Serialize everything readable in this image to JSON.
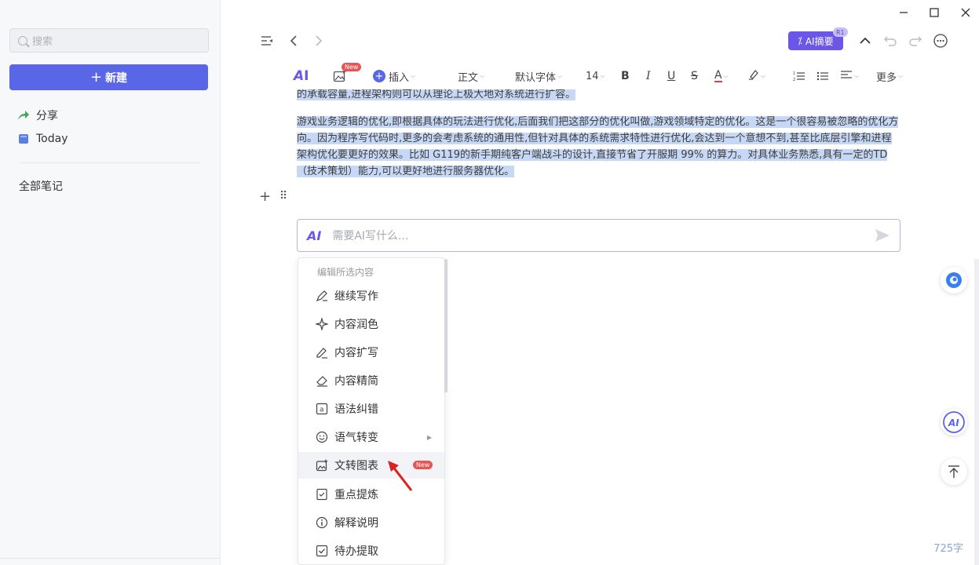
{
  "sidebar": {
    "search_placeholder": "搜索",
    "new_button": "新建",
    "items": [
      {
        "label": "分享",
        "icon": "share-arrow-icon"
      },
      {
        "label": "Today",
        "icon": "notebook-icon"
      }
    ],
    "all_notes": "全部笔记"
  },
  "topbar": {
    "ai_summary": "AI摘要",
    "r1_badge": "R1"
  },
  "toolbar": {
    "insert": "插入",
    "new_badge": "New",
    "paragraph_style": "正文",
    "font": "默认字体",
    "font_size": "14",
    "bold": "B",
    "italic": "I",
    "underline": "U",
    "strike": "S",
    "font_color": "A",
    "more": "更多"
  },
  "content": {
    "line_cut": "的承载容量,进程架构则可以从理论上极大地对系统进行扩容。",
    "paragraph": "游戏业务逻辑的优化,即根据具体的玩法进行优化,后面我们把这部分的优化叫做,游戏领域特定的优化。这是一个很容易被忽略的优化方向。因为程序写代码时,更多的会考虑系统的通用性,但针对具体的系统需求特性进行优化,会达到一个意想不到,甚至比底层引擎和进程架构优化要更好的效果。比如 G119的新手期纯客户端战斗的设计,直接节省了开服期 99% 的算力。对具体业务熟悉,具有一定的TD（技术策划）能力,可以更好地进行服务器优化。"
  },
  "ai_input": {
    "logo": "AI",
    "placeholder": "需要AI写什么..."
  },
  "menu": {
    "header": "编辑所选内容",
    "items": [
      {
        "label": "继续写作",
        "icon": "pen-write-icon"
      },
      {
        "label": "内容润色",
        "icon": "sparkle-icon"
      },
      {
        "label": "内容扩写",
        "icon": "pencil-icon"
      },
      {
        "label": "内容精简",
        "icon": "eraser-icon"
      },
      {
        "label": "语法纠错",
        "icon": "grammar-a-icon"
      },
      {
        "label": "语气转变",
        "icon": "smiley-icon"
      },
      {
        "label": "文转图表",
        "icon": "image-chart-icon"
      },
      {
        "label": "重点提炼",
        "icon": "bookmark-check-icon"
      },
      {
        "label": "解释说明",
        "icon": "info-icon"
      },
      {
        "label": "待办提取",
        "icon": "todo-check-icon"
      }
    ],
    "new_badge": "New"
  },
  "footer": {
    "word_count": "725字"
  },
  "colors": {
    "accent": "#5a66e8",
    "ai_purple": "#6a57e8",
    "highlight": "#c6d8f5",
    "badge_red": "#e85353"
  }
}
